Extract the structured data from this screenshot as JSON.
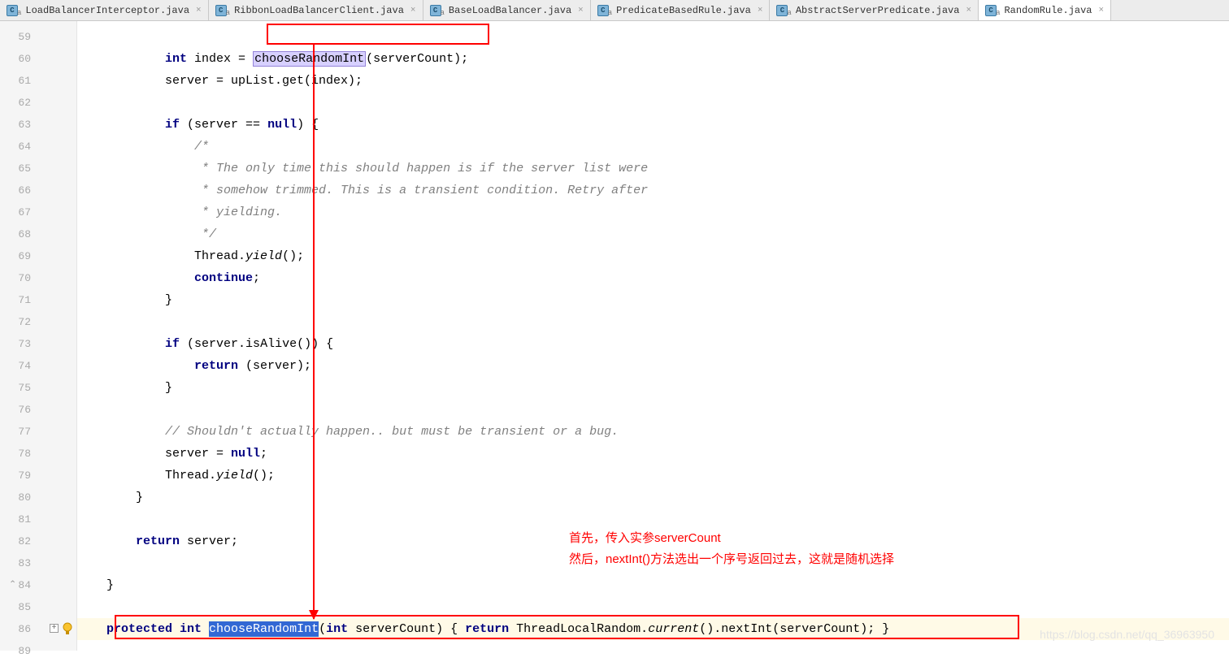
{
  "tabs": [
    {
      "label": "LoadBalancerInterceptor.java",
      "active": false
    },
    {
      "label": "RibbonLoadBalancerClient.java",
      "active": false
    },
    {
      "label": "BaseLoadBalancer.java",
      "active": false
    },
    {
      "label": "PredicateBasedRule.java",
      "active": false
    },
    {
      "label": "AbstractServerPredicate.java",
      "active": false
    },
    {
      "label": "RandomRule.java",
      "active": true
    }
  ],
  "lines": {
    "start": 59,
    "end": 89
  },
  "code": {
    "l60a": "            ",
    "l60b": "int",
    "l60c": " index = ",
    "l60d": "chooseRandomInt",
    "l60e": "(serverCount);",
    "l61": "            server = upList.get(index);",
    "l63a": "            ",
    "l63b": "if",
    "l63c": " (server == ",
    "l63d": "null",
    "l63e": ") {",
    "l64": "                /*",
    "l65": "                 * The only time this should happen is if the server list were",
    "l66": "                 * somehow trimmed. This is a transient condition. Retry after",
    "l67": "                 * yielding.",
    "l68": "                 */",
    "l69a": "                Thread.",
    "l69b": "yield",
    "l69c": "();",
    "l70a": "                ",
    "l70b": "continue",
    "l70c": ";",
    "l71": "            }",
    "l73a": "            ",
    "l73b": "if",
    "l73c": " (server.isAlive()) {",
    "l74a": "                ",
    "l74b": "return",
    "l74c": " (server);",
    "l75": "            }",
    "l77": "            // Shouldn't actually happen.. but must be transient or a bug.",
    "l78a": "            server = ",
    "l78b": "null",
    "l78c": ";",
    "l79a": "            Thread.",
    "l79b": "yield",
    "l79c": "();",
    "l80": "        }",
    "l82a": "        ",
    "l82b": "return",
    "l82c": " server;",
    "l84": "    }",
    "l86a": "    ",
    "l86b": "protected int ",
    "l86c": "chooseRandomInt",
    "l86d": "(",
    "l86e": "int",
    "l86f": " serverCount) { ",
    "l86g": "return",
    "l86h": " ThreadLocalRandom.",
    "l86i": "current",
    "l86j": "().nextInt(serverCount); }"
  },
  "annotations": {
    "line1": "首先，传入实参serverCount",
    "line2": "然后，nextInt()方法选出一个序号返回过去，这就是随机选择"
  },
  "watermark": "https://blog.csdn.net/qq_36963950"
}
